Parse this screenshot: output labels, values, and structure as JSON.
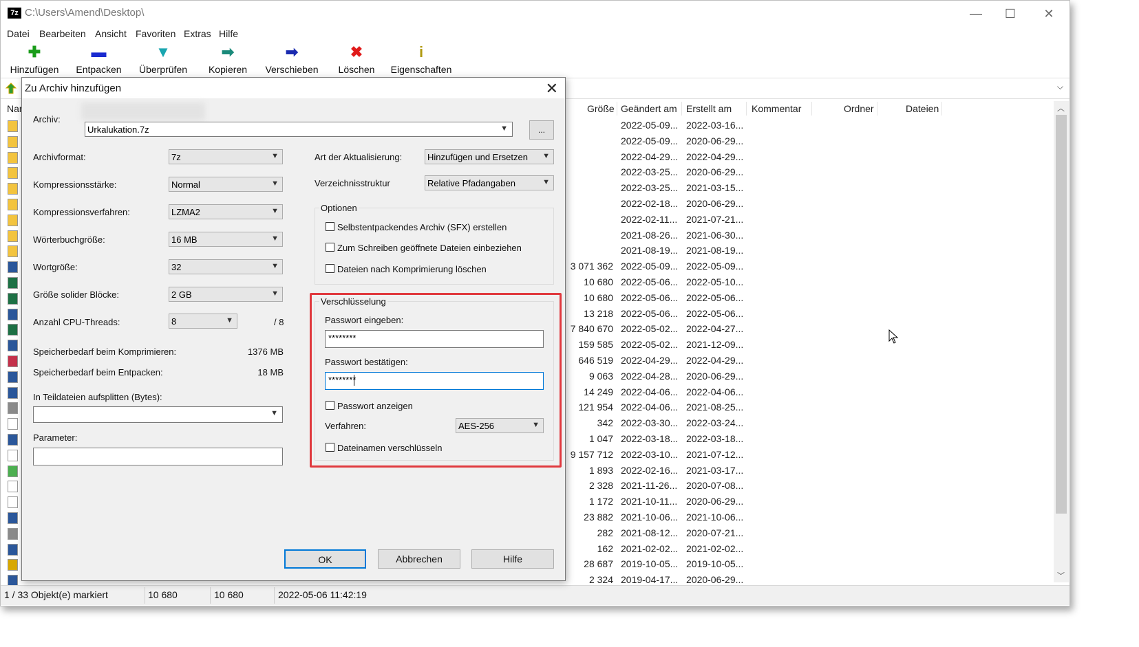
{
  "window": {
    "app_icon": "7z",
    "path": "C:\\Users\\Amend\\Desktop\\",
    "controls": {
      "minimize": "—",
      "maximize": "☐",
      "close": "✕"
    }
  },
  "menu": [
    "Datei",
    "Bearbeiten",
    "Ansicht",
    "Favoriten",
    "Extras",
    "Hilfe"
  ],
  "toolbar": [
    {
      "label": "Hinzufügen",
      "icon": "plus-icon",
      "color": "#1a9c1a",
      "glyph": "✚"
    },
    {
      "label": "Entpacken",
      "icon": "minus-icon",
      "color": "#1a2bd0",
      "glyph": "▬"
    },
    {
      "label": "Überprüfen",
      "icon": "check-icon",
      "color": "#1aa6b0",
      "glyph": "▼"
    },
    {
      "label": "Kopieren",
      "icon": "copy-arrow-icon",
      "color": "#1a8a7a",
      "glyph": "➡"
    },
    {
      "label": "Verschieben",
      "icon": "move-arrow-icon",
      "color": "#1a2bb0",
      "glyph": "➡"
    },
    {
      "label": "Löschen",
      "icon": "delete-icon",
      "color": "#e01a1a",
      "glyph": "✖"
    },
    {
      "label": "Eigenschaften",
      "icon": "info-icon",
      "color": "#b09a10",
      "glyph": "i"
    }
  ],
  "columns": {
    "name": "Nar",
    "size": "Größe",
    "modified": "Geändert am",
    "created": "Erstellt am",
    "comment": "Kommentar",
    "folders": "Ordner",
    "files": "Dateien"
  },
  "files": [
    {
      "size": "",
      "modified": "2022-05-09...",
      "created": "2022-03-16..."
    },
    {
      "size": "",
      "modified": "2022-05-09...",
      "created": "2020-06-29..."
    },
    {
      "size": "",
      "modified": "2022-04-29...",
      "created": "2022-04-29..."
    },
    {
      "size": "",
      "modified": "2022-03-25...",
      "created": "2020-06-29..."
    },
    {
      "size": "",
      "modified": "2022-03-25...",
      "created": "2021-03-15..."
    },
    {
      "size": "",
      "modified": "2022-02-18...",
      "created": "2020-06-29..."
    },
    {
      "size": "",
      "modified": "2022-02-11...",
      "created": "2021-07-21..."
    },
    {
      "size": "",
      "modified": "2021-08-26...",
      "created": "2021-06-30..."
    },
    {
      "size": "",
      "modified": "2021-08-19...",
      "created": "2021-08-19..."
    },
    {
      "size": "3 071 362",
      "modified": "2022-05-09...",
      "created": "2022-05-09..."
    },
    {
      "size": "10 680",
      "modified": "2022-05-06...",
      "created": "2022-05-10..."
    },
    {
      "size": "10 680",
      "modified": "2022-05-06...",
      "created": "2022-05-06..."
    },
    {
      "size": "13 218",
      "modified": "2022-05-06...",
      "created": "2022-05-06..."
    },
    {
      "size": "7 840 670",
      "modified": "2022-05-02...",
      "created": "2022-04-27..."
    },
    {
      "size": "159 585",
      "modified": "2022-05-02...",
      "created": "2021-12-09..."
    },
    {
      "size": "646 519",
      "modified": "2022-04-29...",
      "created": "2022-04-29..."
    },
    {
      "size": "9 063",
      "modified": "2022-04-28...",
      "created": "2020-06-29..."
    },
    {
      "size": "14 249",
      "modified": "2022-04-06...",
      "created": "2022-04-06..."
    },
    {
      "size": "121 954",
      "modified": "2022-04-06...",
      "created": "2021-08-25..."
    },
    {
      "size": "342",
      "modified": "2022-03-30...",
      "created": "2022-03-24..."
    },
    {
      "size": "1 047",
      "modified": "2022-03-18...",
      "created": "2022-03-18..."
    },
    {
      "size": "9 157 712",
      "modified": "2022-03-10...",
      "created": "2021-07-12..."
    },
    {
      "size": "1 893",
      "modified": "2022-02-16...",
      "created": "2021-03-17..."
    },
    {
      "size": "2 328",
      "modified": "2021-11-26...",
      "created": "2020-07-08..."
    },
    {
      "size": "1 172",
      "modified": "2021-10-11...",
      "created": "2020-06-29..."
    },
    {
      "size": "23 882",
      "modified": "2021-10-06...",
      "created": "2021-10-06..."
    },
    {
      "size": "282",
      "modified": "2021-08-12...",
      "created": "2020-07-21..."
    },
    {
      "size": "162",
      "modified": "2021-02-02...",
      "created": "2021-02-02..."
    },
    {
      "size": "28 687",
      "modified": "2019-10-05...",
      "created": "2019-10-05..."
    },
    {
      "size": "2 324",
      "modified": "2019-04-17...",
      "created": "2020-06-29..."
    }
  ],
  "status": {
    "selected": "1 / 33 Objekt(e) markiert",
    "size1": "10 680",
    "size2": "10 680",
    "date": "2022-05-06 11:42:19"
  },
  "dialog": {
    "title": "Zu Archiv hinzufügen",
    "close": "✕",
    "archive_label": "Archiv:",
    "archive_value": "Urkalukation.7z",
    "browse_label": "...",
    "format_label": "Archivformat:",
    "format_value": "7z",
    "level_label": "Kompressionsstärke:",
    "level_value": "Normal",
    "method_label": "Kompressionsverfahren:",
    "method_value": "LZMA2",
    "dict_label": "Wörterbuchgröße:",
    "dict_value": "16 MB",
    "word_label": "Wortgröße:",
    "word_value": "32",
    "solid_label": "Größe solider Blöcke:",
    "solid_value": "2 GB",
    "threads_label": "Anzahl CPU-Threads:",
    "threads_value": "8",
    "threads_max": "/ 8",
    "mem_compress_label": "Speicherbedarf beim Komprimieren:",
    "mem_compress_value": "1376 MB",
    "mem_decompress_label": "Speicherbedarf beim Entpacken:",
    "mem_decompress_value": "18 MB",
    "split_label": "In Teildateien aufsplitten (Bytes):",
    "split_value": "",
    "params_label": "Parameter:",
    "params_value": "",
    "update_label": "Art der Aktualisierung:",
    "update_value": "Hinzufügen und Ersetzen",
    "paths_label": "Verzeichnisstruktur",
    "paths_value": "Relative Pfadangaben",
    "options_title": "Optionen",
    "opt_sfx": "Selbstentpackendes Archiv (SFX) erstellen",
    "opt_shared": "Zum Schreiben geöffnete Dateien einbeziehen",
    "opt_delete": "Dateien nach Komprimierung löschen",
    "enc_title": "Verschlüsselung",
    "pw_label": "Passwort eingeben:",
    "pw_value": "********",
    "pw2_label": "Passwort bestätigen:",
    "pw2_value": "********",
    "show_pw": "Passwort anzeigen",
    "enc_method_label": "Verfahren:",
    "enc_method_value": "AES-256",
    "enc_names": "Dateinamen verschlüsseln",
    "ok": "OK",
    "cancel": "Abbrechen",
    "help": "Hilfe"
  },
  "colors": {
    "highlight": "#e0393e",
    "dialog_bg": "#f0f0f0",
    "focus_border": "#0078d7"
  }
}
